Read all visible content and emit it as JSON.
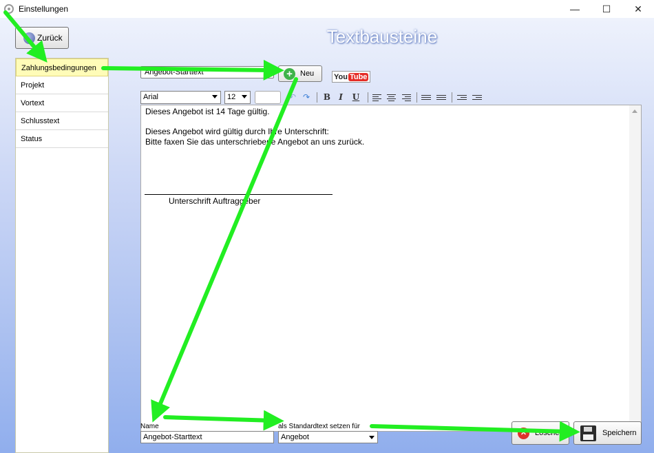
{
  "window": {
    "title": "Einstellungen",
    "controls": {
      "minimize": "—",
      "maximize": "☐",
      "close": "✕"
    }
  },
  "header": {
    "back_label": "Zurück",
    "page_title": "Textbausteine"
  },
  "sidebar": {
    "items": [
      {
        "label": "Zahlungsbedingungen",
        "active": true
      },
      {
        "label": "Projekt"
      },
      {
        "label": "Vortext"
      },
      {
        "label": "Schlusstext"
      },
      {
        "label": "Status"
      }
    ]
  },
  "top": {
    "name_value": "Angebot-Starttext",
    "new_label": "Neu",
    "youtube": {
      "you": "You",
      "tube": "Tube"
    }
  },
  "toolbar": {
    "font": "Arial",
    "size": "12",
    "undo": "↶",
    "redo": "↷",
    "bold": "B",
    "italic": "I",
    "underline": "U"
  },
  "editor": {
    "lines": [
      "Dieses Angebot ist 14 Tage gültig.",
      "",
      "Dieses Angebot wird gültig durch Ihre Unterschrift:",
      "Bitte faxen Sie das unterschriebene Angebot an uns zurück."
    ],
    "signature_label": "Unterschrift Auftraggeber"
  },
  "bottom": {
    "name_label": "Name",
    "name_value": "Angebot-Starttext",
    "standard_label": "als Standardtext setzen für",
    "standard_value": "Angebot",
    "delete_label": "Löschen",
    "save_label": "Speichern"
  },
  "colors": {
    "annotation_arrow": "#22ee22",
    "active_item": "#fffcb8",
    "background_bottom": "#90aeed"
  }
}
